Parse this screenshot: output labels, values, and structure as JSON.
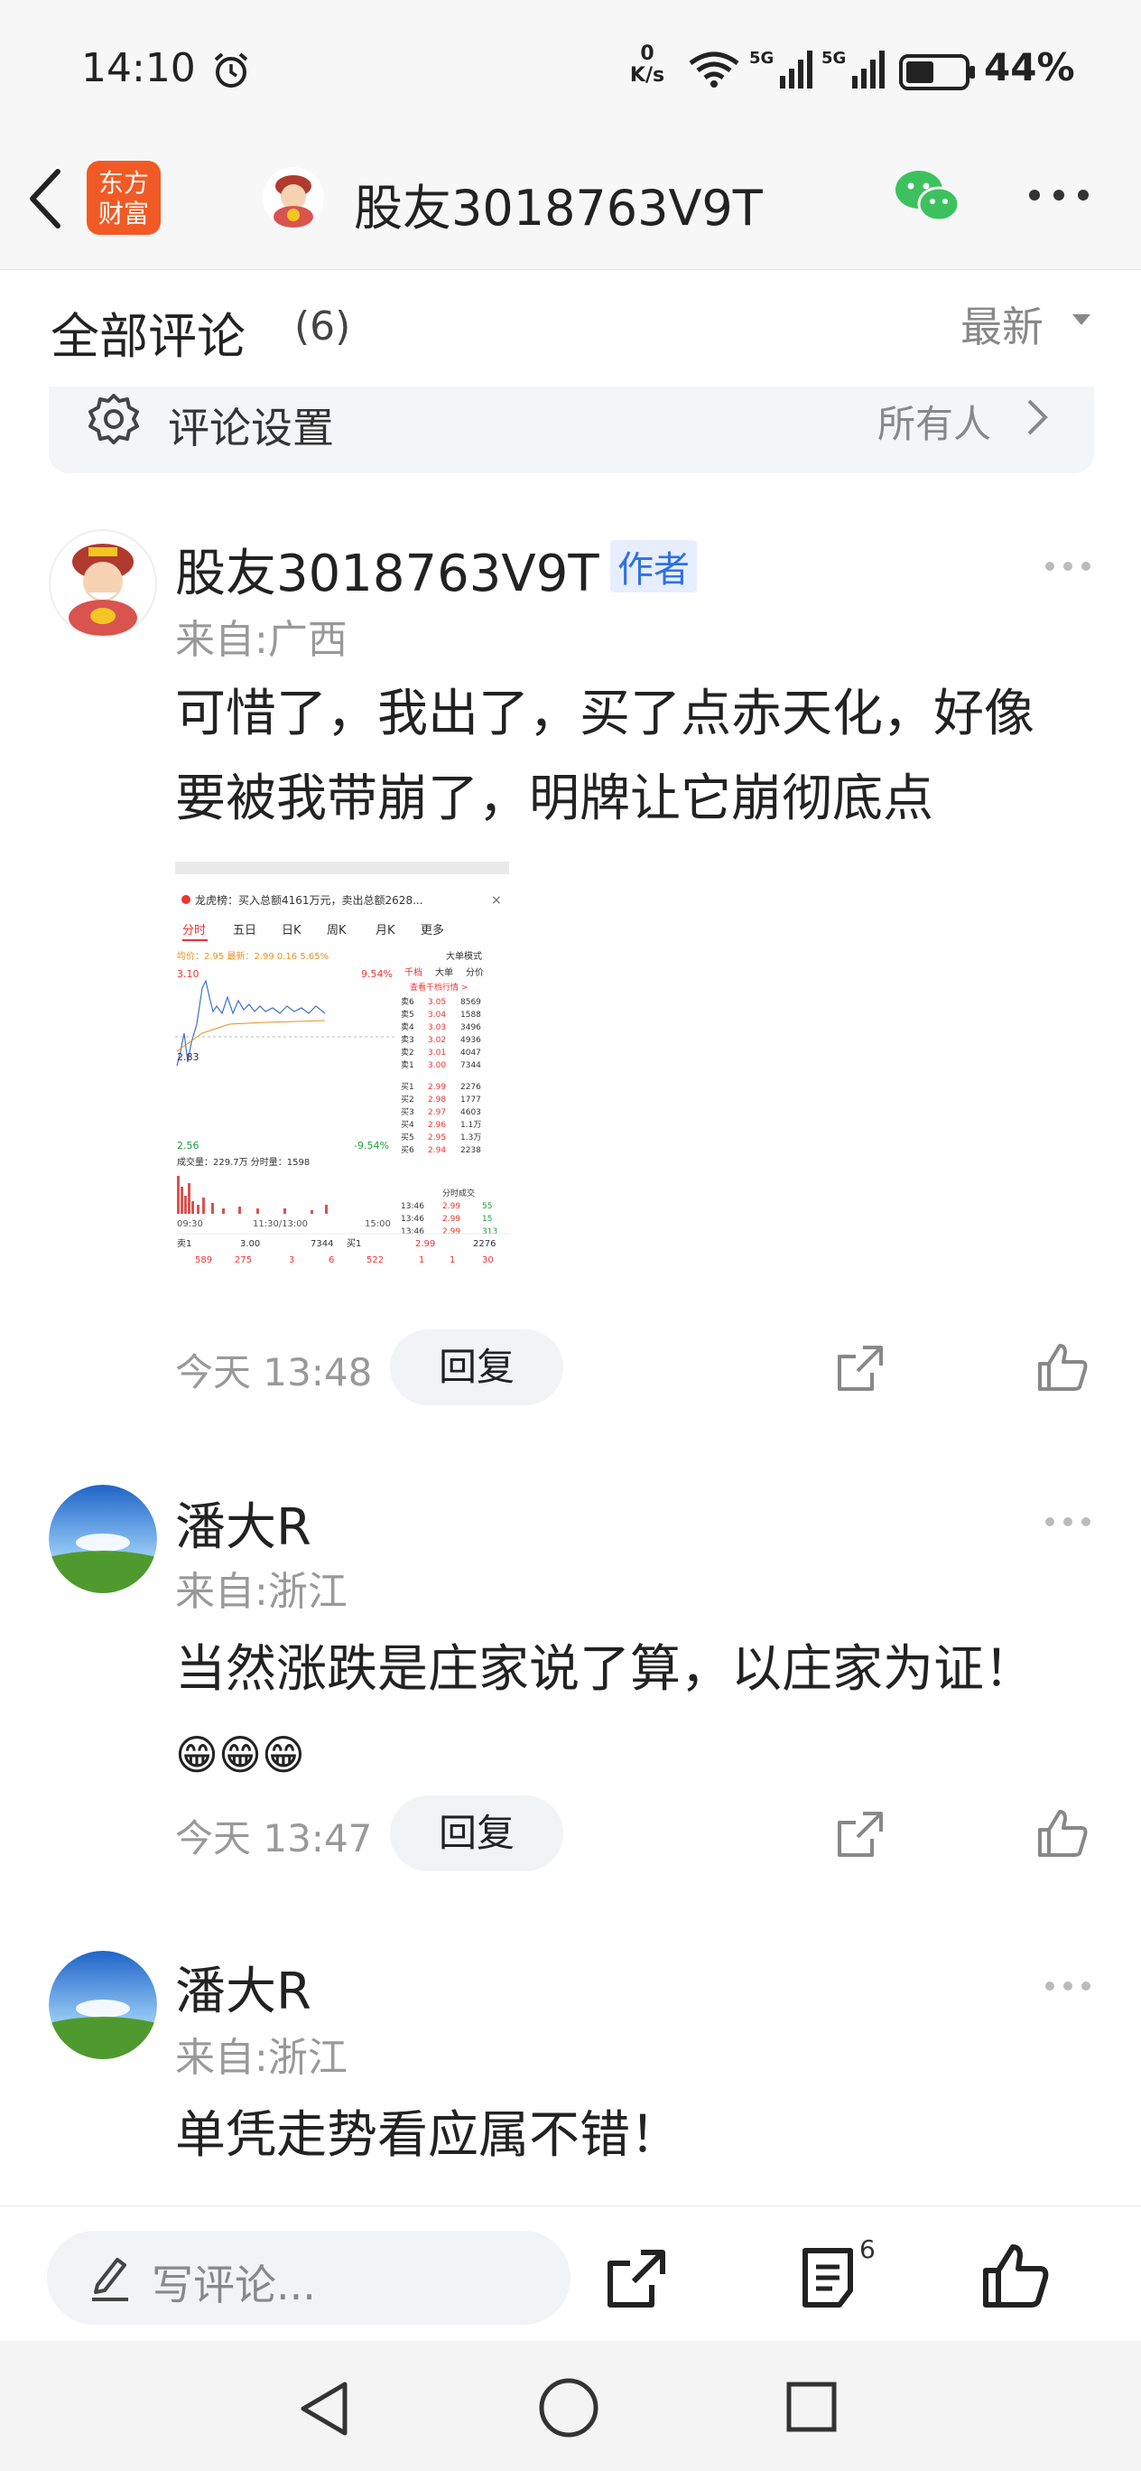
{
  "status_bar": {
    "time": "14:10",
    "net_speed_value": "0",
    "net_speed_unit": "K/s",
    "signal1": "5G",
    "signal2": "5G",
    "battery": "44%"
  },
  "header": {
    "logo_line1": "东方",
    "logo_line2": "财富",
    "title": "股友3018763V9T"
  },
  "comments_section": {
    "title": "全部评论",
    "count": "(6)",
    "sort": "最新",
    "settings_label": "评论设置",
    "settings_value": "所有人"
  },
  "comments": [
    {
      "username": "股友3018763V9T",
      "badge": "作者",
      "location": "来自:广西",
      "content_line1": "可惜了，我出了，买了点赤天化，好像",
      "content_line2": "要被我带崩了，明牌让它崩彻底点",
      "time": "今天 13:48",
      "reply": "回复"
    },
    {
      "username": "潘大R",
      "location": "来自:浙江",
      "content_line1": "当然涨跌是庄家说了算，以庄家为证！",
      "emojis": "😁😁😁",
      "time": "今天 13:47",
      "reply": "回复"
    },
    {
      "username": "潘大R",
      "location": "来自:浙江",
      "content_line1": "单凭走势看应属不错！"
    }
  ],
  "stock_image": {
    "banner": "龙虎榜：买入总额4161万元，卖出总额2628...",
    "tabs": [
      "分时",
      "五日",
      "日K",
      "周K",
      "月K",
      "更多"
    ],
    "avg_line": "均价：2.95 最新：2.99 0.16 5.65%",
    "big_order": "大单模式",
    "top_price": "3.10",
    "top_pct": "9.54%",
    "mid_price": "2.83",
    "low_price": "2.56",
    "low_pct": "-9.54%",
    "volume_row": "成交量：229.7万  分时量：1598",
    "time_axis": [
      "09:30",
      "11:30/13:00",
      "15:00"
    ],
    "right_tabs": [
      "千档",
      "大单",
      "分价"
    ],
    "right_link": "查看千档行情 >",
    "sell_orders": [
      [
        "卖6",
        "3.05",
        "8569"
      ],
      [
        "卖5",
        "3.04",
        "1588"
      ],
      [
        "卖4",
        "3.03",
        "3496"
      ],
      [
        "卖3",
        "3.02",
        "4936"
      ],
      [
        "卖2",
        "3.01",
        "4047"
      ],
      [
        "卖1",
        "3.00",
        "7344"
      ]
    ],
    "buy_orders": [
      [
        "买1",
        "2.99",
        "2276"
      ],
      [
        "买2",
        "2.98",
        "1777"
      ],
      [
        "买3",
        "2.97",
        "4603"
      ],
      [
        "买4",
        "2.96",
        "1.1万"
      ],
      [
        "买5",
        "2.95",
        "1.3万"
      ],
      [
        "买6",
        "2.94",
        "2238"
      ]
    ],
    "trades_title": "分时成交",
    "trades": [
      [
        "13:46",
        "2.99",
        "55"
      ],
      [
        "13:46",
        "2.99",
        "15"
      ],
      [
        "13:46",
        "2.99",
        "313"
      ]
    ],
    "bottom_row1": [
      "卖1",
      "3.00",
      "7344",
      "买1",
      "2.99",
      "2276"
    ],
    "bottom_row2": [
      "589",
      "275",
      "3",
      "6",
      "522",
      "1",
      "1",
      "30"
    ]
  },
  "bottom_bar": {
    "placeholder": "写评论...",
    "comments_count": "6"
  },
  "colors": {
    "brand": "#f15a24",
    "author_badge_bg": "#e6eeff",
    "author_badge_text": "#2f6fe6",
    "wechat": "#3dc15e"
  }
}
